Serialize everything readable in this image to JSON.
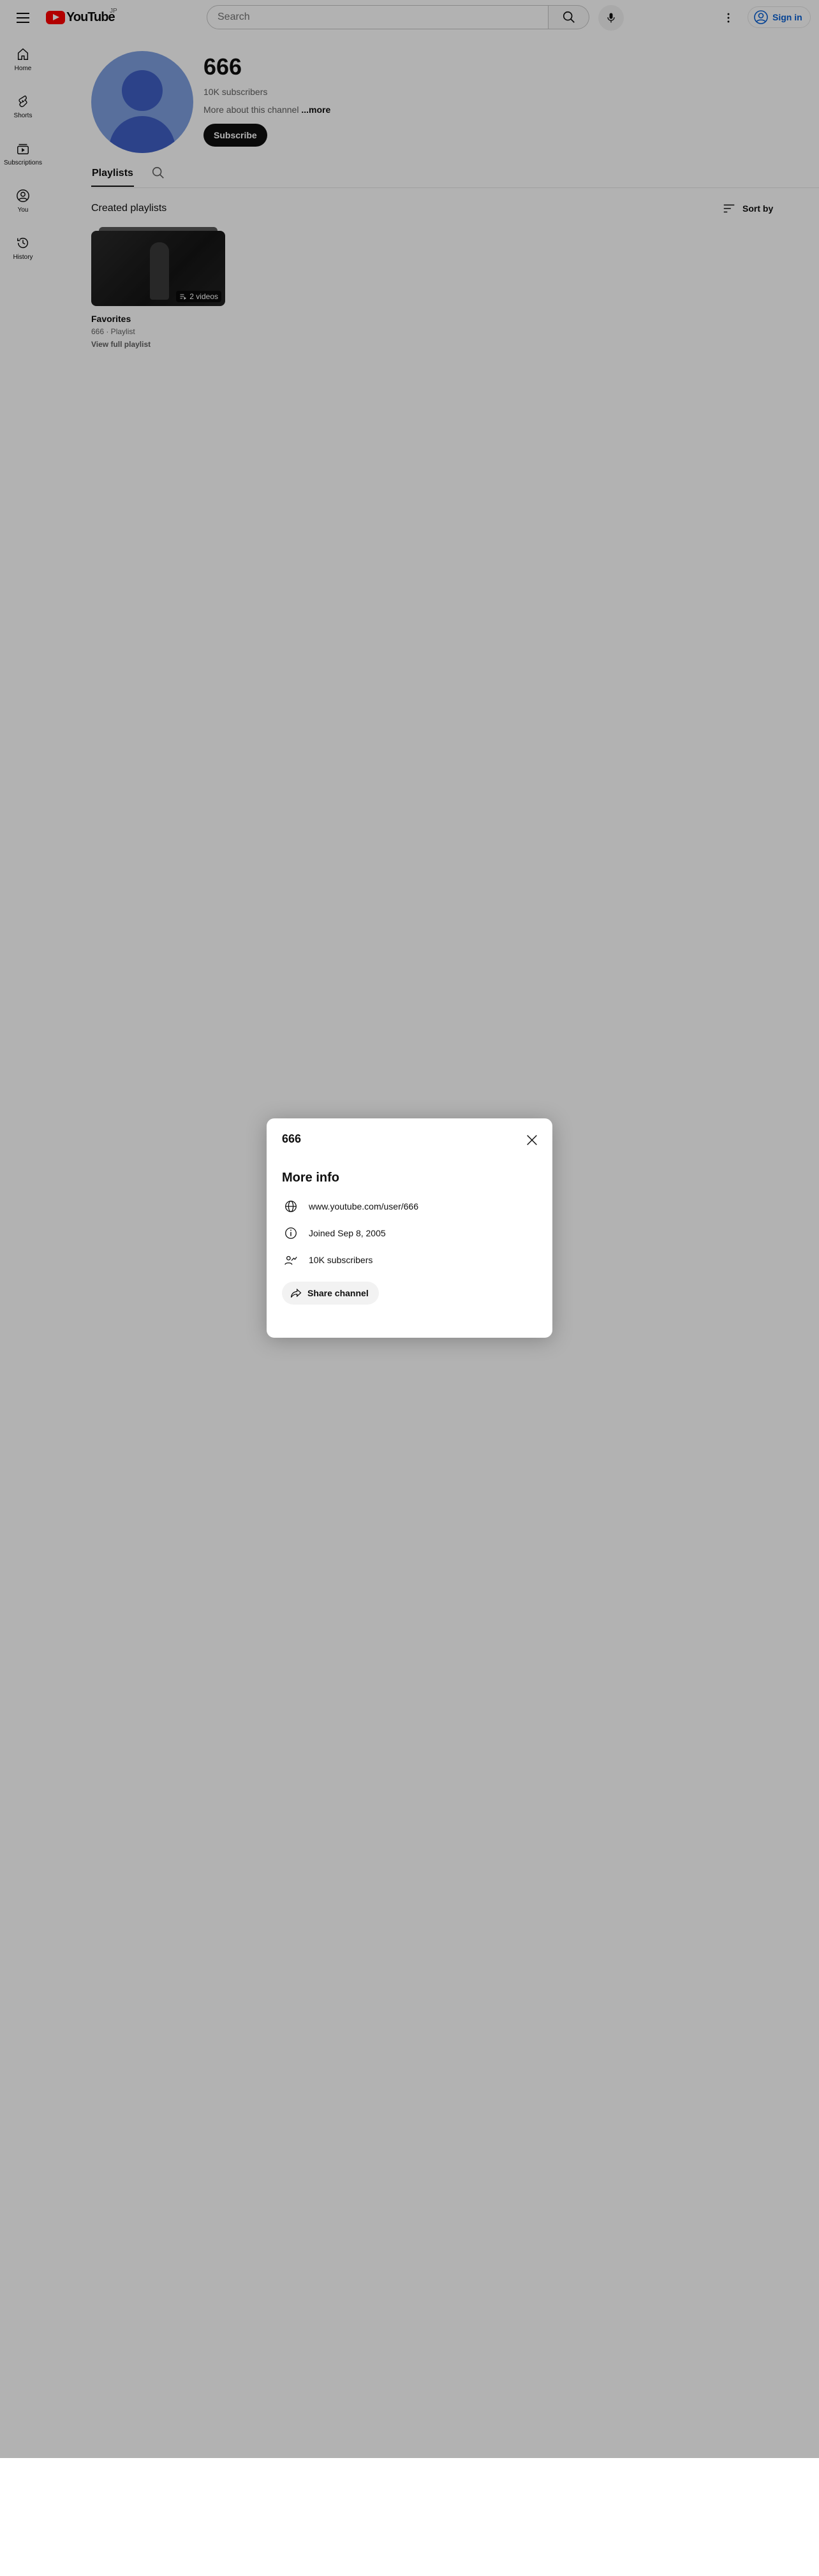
{
  "masthead": {
    "logo_text": "YouTube",
    "country_code": "JP",
    "search_placeholder": "Search",
    "sign_in_label": "Sign in"
  },
  "guide": {
    "items": [
      {
        "label": "Home",
        "icon": "home-icon"
      },
      {
        "label": "Shorts",
        "icon": "shorts-icon"
      },
      {
        "label": "Subscriptions",
        "icon": "subscriptions-icon"
      },
      {
        "label": "You",
        "icon": "you-icon"
      },
      {
        "label": "History",
        "icon": "history-icon"
      }
    ]
  },
  "channel": {
    "name": "666",
    "subscribers": "10K subscribers",
    "about_text": "More about this channel",
    "more_label": "...more",
    "subscribe_label": "Subscribe"
  },
  "tabs": {
    "active": "Playlists"
  },
  "playlists": {
    "section_title": "Created playlists",
    "sort_label": "Sort by",
    "items": [
      {
        "title": "Favorites",
        "meta": "666 · Playlist",
        "link": "View full playlist",
        "badge": "2 videos"
      }
    ]
  },
  "dialog": {
    "title": "666",
    "heading": "More info",
    "url": "www.youtube.com/user/666",
    "joined": "Joined Sep 8, 2005",
    "subscribers": "10K subscribers",
    "share_label": "Share channel"
  },
  "colors": {
    "brand_red": "#ff0000",
    "link_blue": "#065fd4",
    "scrim": "rgba(0,0,0,0.3)"
  }
}
